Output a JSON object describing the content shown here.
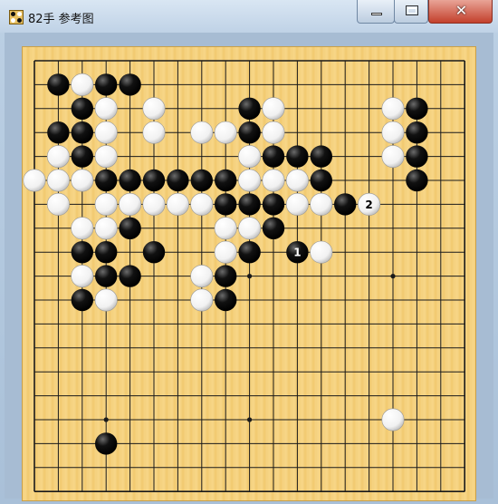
{
  "window": {
    "title": "82手 参考图",
    "controls": {
      "minimize": "minimize",
      "maximize": "maximize",
      "close": "✕"
    }
  },
  "board": {
    "size": 19,
    "colors": {
      "board": "#f5d17e",
      "line": "#1a1a1a",
      "black": "#111111",
      "white": "#ffffff"
    },
    "star_points": [
      [
        3,
        3
      ],
      [
        9,
        3
      ],
      [
        15,
        3
      ],
      [
        3,
        9
      ],
      [
        9,
        9
      ],
      [
        15,
        9
      ],
      [
        3,
        15
      ],
      [
        9,
        15
      ],
      [
        15,
        15
      ]
    ],
    "stones": [
      {
        "c": "b",
        "x": 1,
        "y": 1
      },
      {
        "c": "w",
        "x": 2,
        "y": 1
      },
      {
        "c": "b",
        "x": 3,
        "y": 1
      },
      {
        "c": "b",
        "x": 4,
        "y": 1
      },
      {
        "c": "b",
        "x": 2,
        "y": 2
      },
      {
        "c": "w",
        "x": 3,
        "y": 2
      },
      {
        "c": "w",
        "x": 5,
        "y": 2
      },
      {
        "c": "b",
        "x": 9,
        "y": 2
      },
      {
        "c": "w",
        "x": 10,
        "y": 2
      },
      {
        "c": "w",
        "x": 15,
        "y": 2
      },
      {
        "c": "b",
        "x": 16,
        "y": 2
      },
      {
        "c": "b",
        "x": 1,
        "y": 3
      },
      {
        "c": "b",
        "x": 2,
        "y": 3
      },
      {
        "c": "w",
        "x": 3,
        "y": 3
      },
      {
        "c": "w",
        "x": 5,
        "y": 3
      },
      {
        "c": "w",
        "x": 7,
        "y": 3
      },
      {
        "c": "w",
        "x": 8,
        "y": 3
      },
      {
        "c": "b",
        "x": 9,
        "y": 3
      },
      {
        "c": "w",
        "x": 10,
        "y": 3
      },
      {
        "c": "w",
        "x": 15,
        "y": 3
      },
      {
        "c": "b",
        "x": 16,
        "y": 3
      },
      {
        "c": "w",
        "x": 1,
        "y": 4
      },
      {
        "c": "b",
        "x": 2,
        "y": 4
      },
      {
        "c": "w",
        "x": 3,
        "y": 4
      },
      {
        "c": "w",
        "x": 9,
        "y": 4
      },
      {
        "c": "b",
        "x": 10,
        "y": 4
      },
      {
        "c": "b",
        "x": 11,
        "y": 4
      },
      {
        "c": "b",
        "x": 12,
        "y": 4
      },
      {
        "c": "w",
        "x": 15,
        "y": 4
      },
      {
        "c": "b",
        "x": 16,
        "y": 4
      },
      {
        "c": "w",
        "x": 0,
        "y": 5
      },
      {
        "c": "w",
        "x": 1,
        "y": 5
      },
      {
        "c": "w",
        "x": 2,
        "y": 5
      },
      {
        "c": "b",
        "x": 3,
        "y": 5
      },
      {
        "c": "b",
        "x": 4,
        "y": 5
      },
      {
        "c": "b",
        "x": 5,
        "y": 5
      },
      {
        "c": "b",
        "x": 6,
        "y": 5
      },
      {
        "c": "b",
        "x": 7,
        "y": 5
      },
      {
        "c": "b",
        "x": 8,
        "y": 5
      },
      {
        "c": "w",
        "x": 9,
        "y": 5
      },
      {
        "c": "w",
        "x": 10,
        "y": 5
      },
      {
        "c": "w",
        "x": 11,
        "y": 5
      },
      {
        "c": "b",
        "x": 12,
        "y": 5
      },
      {
        "c": "b",
        "x": 16,
        "y": 5
      },
      {
        "c": "w",
        "x": 1,
        "y": 6
      },
      {
        "c": "w",
        "x": 3,
        "y": 6
      },
      {
        "c": "w",
        "x": 4,
        "y": 6
      },
      {
        "c": "w",
        "x": 5,
        "y": 6
      },
      {
        "c": "w",
        "x": 6,
        "y": 6
      },
      {
        "c": "w",
        "x": 7,
        "y": 6
      },
      {
        "c": "b",
        "x": 8,
        "y": 6
      },
      {
        "c": "b",
        "x": 9,
        "y": 6
      },
      {
        "c": "b",
        "x": 10,
        "y": 6
      },
      {
        "c": "w",
        "x": 11,
        "y": 6
      },
      {
        "c": "w",
        "x": 12,
        "y": 6
      },
      {
        "c": "b",
        "x": 13,
        "y": 6
      },
      {
        "c": "w",
        "x": 14,
        "y": 6,
        "label": "2"
      },
      {
        "c": "w",
        "x": 2,
        "y": 7
      },
      {
        "c": "w",
        "x": 3,
        "y": 7
      },
      {
        "c": "b",
        "x": 4,
        "y": 7
      },
      {
        "c": "w",
        "x": 8,
        "y": 7
      },
      {
        "c": "w",
        "x": 9,
        "y": 7
      },
      {
        "c": "b",
        "x": 10,
        "y": 7
      },
      {
        "c": "b",
        "x": 2,
        "y": 8
      },
      {
        "c": "b",
        "x": 3,
        "y": 8
      },
      {
        "c": "b",
        "x": 5,
        "y": 8
      },
      {
        "c": "w",
        "x": 8,
        "y": 8
      },
      {
        "c": "b",
        "x": 9,
        "y": 8
      },
      {
        "c": "b",
        "x": 11,
        "y": 8,
        "label": "1"
      },
      {
        "c": "w",
        "x": 12,
        "y": 8
      },
      {
        "c": "w",
        "x": 2,
        "y": 9
      },
      {
        "c": "b",
        "x": 3,
        "y": 9
      },
      {
        "c": "b",
        "x": 4,
        "y": 9
      },
      {
        "c": "w",
        "x": 7,
        "y": 9
      },
      {
        "c": "b",
        "x": 8,
        "y": 9
      },
      {
        "c": "b",
        "x": 2,
        "y": 10
      },
      {
        "c": "w",
        "x": 3,
        "y": 10
      },
      {
        "c": "w",
        "x": 7,
        "y": 10
      },
      {
        "c": "b",
        "x": 8,
        "y": 10
      },
      {
        "c": "w",
        "x": 15,
        "y": 15
      },
      {
        "c": "b",
        "x": 3,
        "y": 16
      }
    ]
  }
}
